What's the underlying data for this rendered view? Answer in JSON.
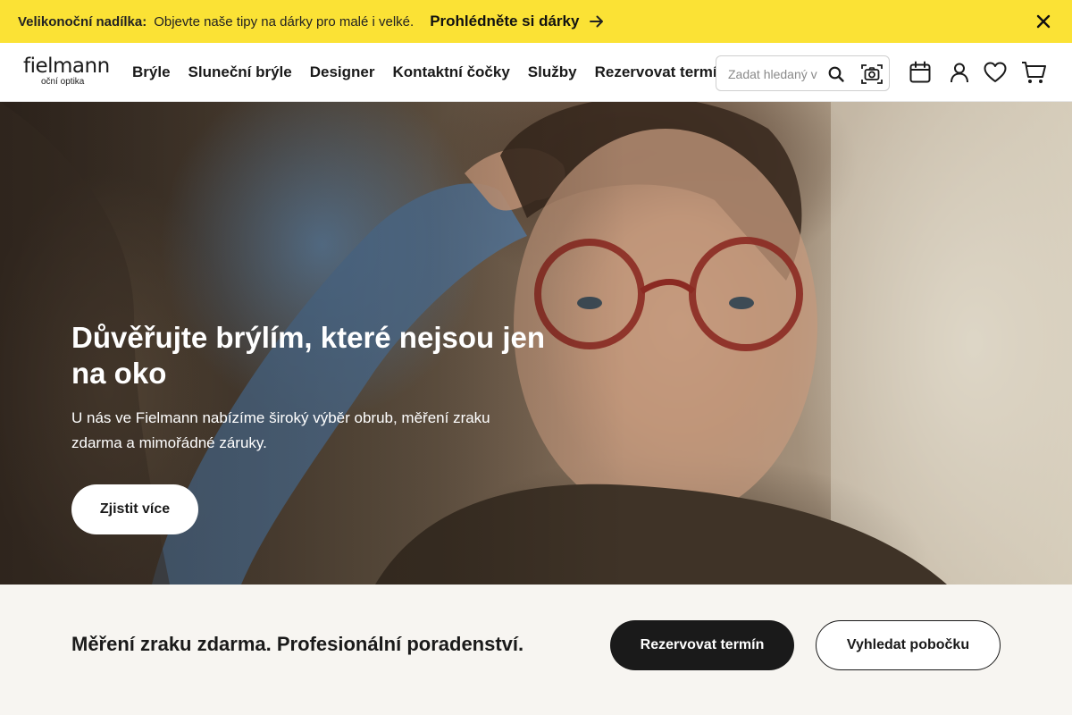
{
  "promo": {
    "title": "Velikonoční nadílka:",
    "text": "Objevte naše tipy na dárky pro malé i velké.",
    "link": "Prohlédněte si dárky",
    "background": "#fbe235"
  },
  "header": {
    "logo_word": "fielmann",
    "logo_sub": "oční optika",
    "nav": [
      "Brýle",
      "Sluneční brýle",
      "Designer",
      "Kontaktní čočky",
      "Služby",
      "Rezervovat termín"
    ],
    "search_placeholder": "Zadat hledaný výraz",
    "icons": [
      "search-icon",
      "camera-search-icon",
      "calendar-icon",
      "user-icon",
      "heart-icon",
      "cart-icon"
    ]
  },
  "hero": {
    "title": "Důvěřujte brýlím, které nejsou jen na oko",
    "description": "U nás ve Fielmann nabízíme široký výběr obrub, měření zraku zdarma a mimořádné záruky.",
    "button": "Zjistit více"
  },
  "band": {
    "title": "Měření zraku zdarma. Profesionální poradenství.",
    "primary_button": "Rezervovat termín",
    "secondary_button": "Vyhledat pobočku"
  }
}
